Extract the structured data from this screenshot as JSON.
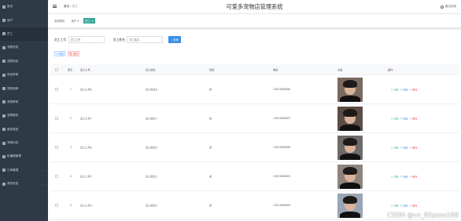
{
  "header": {
    "breadcrumb_home": "首页",
    "breadcrumb_current": "员工",
    "title": "可爱多宠物店管理系统",
    "logout": "退出系统"
  },
  "sidebar": {
    "items": [
      {
        "label": "首页",
        "has_arrow": false
      },
      {
        "label": "用户",
        "has_arrow": false
      },
      {
        "label": "员工",
        "has_arrow": false
      },
      {
        "label": "宠物信息",
        "has_arrow": false
      },
      {
        "label": "宠物用品",
        "has_arrow": false
      },
      {
        "label": "用品种类",
        "has_arrow": false
      },
      {
        "label": "宠物领养",
        "has_arrow": false
      },
      {
        "label": "宠物寄养",
        "has_arrow": false
      },
      {
        "label": "宠物服务",
        "has_arrow": false
      },
      {
        "label": "服务类型",
        "has_arrow": false
      },
      {
        "label": "宠物问答",
        "has_arrow": false
      },
      {
        "label": "轮播图管理",
        "has_arrow": false
      },
      {
        "label": "订单管理",
        "has_arrow": true
      },
      {
        "label": "我的信息",
        "has_arrow": true
      }
    ]
  },
  "tabs": [
    {
      "label": "系统首页",
      "active": false
    },
    {
      "label": "用户 ▾",
      "active": false
    },
    {
      "label": "员工 ×",
      "active": true
    }
  ],
  "search": {
    "label1": "员工工号",
    "placeholder1": "员工工号",
    "label2": "员工姓名",
    "placeholder2": "员工姓名",
    "button": "查询"
  },
  "actions": {
    "add": "增加",
    "delete": "删除"
  },
  "table": {
    "columns": [
      "索引",
      "员工工号",
      "员工姓名",
      "性别",
      "电话",
      "头像",
      "操作"
    ],
    "rows": [
      {
        "index": "1",
        "id": "员工工号8",
        "name": "员工姓名8",
        "gender": "男",
        "phone": "13823888888"
      },
      {
        "index": "2",
        "id": "员工工号7",
        "name": "员工姓名7",
        "gender": "男",
        "phone": "13823888887"
      },
      {
        "index": "3",
        "id": "员工工号6",
        "name": "员工姓名6",
        "gender": "男",
        "phone": "13823888886"
      },
      {
        "index": "4",
        "id": "员工工号5",
        "name": "员工姓名5",
        "gender": "男",
        "phone": "13823888885"
      },
      {
        "index": "5",
        "id": "员工工号4",
        "name": "员工姓名4",
        "gender": "男",
        "phone": "13823888884"
      }
    ],
    "op_detail": "详情",
    "op_edit": "修改",
    "op_delete": "删除"
  },
  "watermark": "CSDN @vx_BSpass188",
  "colors": {
    "sidebar_bg": "#2f3a47",
    "accent_tab": "#3aa59a",
    "primary": "#3a8ee6",
    "danger": "#e86060"
  }
}
